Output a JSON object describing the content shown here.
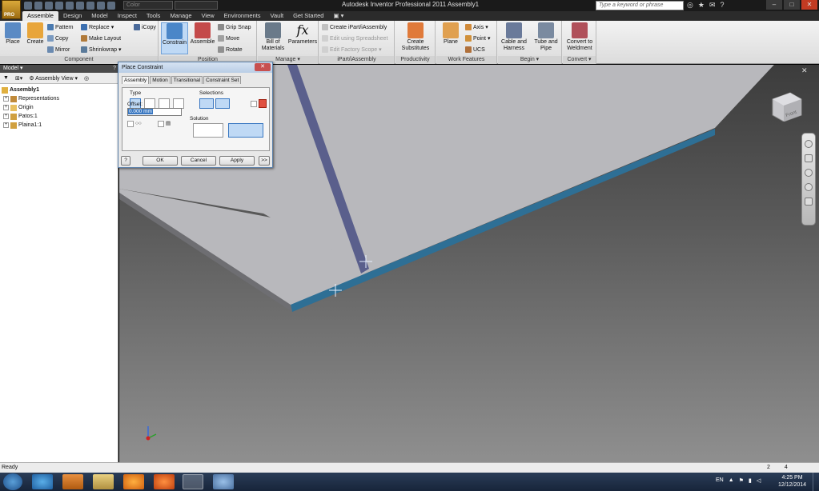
{
  "app": {
    "title": "Autodesk Inventor Professional 2011    Assembly1",
    "logo_text": "PRO",
    "color_combo": "Color",
    "search_placeholder": "Type a keyword or phrase",
    "window_buttons": [
      "–",
      "□",
      "✕"
    ]
  },
  "ribbon": {
    "tabs": [
      "Assemble",
      "Design",
      "Model",
      "Inspect",
      "Tools",
      "Manage",
      "View",
      "Environments",
      "Vault",
      "Get Started"
    ],
    "active_tab": "Assemble",
    "panels": {
      "component": {
        "label": "Component",
        "place": "Place",
        "create": "Create",
        "pattern": "Pattern",
        "copy": "Copy",
        "mirror": "Mirror",
        "replace": "Replace",
        "make_layout": "Make Layout",
        "shrinkwrap": "Shrinkwrap",
        "icopy": "iCopy"
      },
      "position": {
        "label": "Position",
        "constrain": "Constrain",
        "assemble": "Assemble",
        "grip_snap": "Grip Snap",
        "move": "Move",
        "rotate": "Rotate"
      },
      "manage": {
        "label": "Manage",
        "bom_line1": "Bill of",
        "bom_line2": "Materials",
        "parameters": "Parameters"
      },
      "ipart": {
        "label": "iPart/iAssembly",
        "create": "Create iPart/iAssembly",
        "edit_spreadsheet": "Edit using Spreadsheet",
        "edit_scope": "Edit Factory Scope"
      },
      "productivity": {
        "label": "Productivity",
        "create_line1": "Create",
        "create_line2": "Substitutes"
      },
      "work_features": {
        "label": "Work Features",
        "plane": "Plane",
        "axis": "Axis",
        "point": "Point",
        "ucs": "UCS"
      },
      "begin": {
        "label": "Begin",
        "cable_line1": "Cable and",
        "cable_line2": "Harness",
        "tube_line1": "Tube and",
        "tube_line2": "Pipe"
      },
      "convert": {
        "label": "Convert",
        "line1": "Convert to",
        "line2": "Weldment"
      }
    }
  },
  "browser": {
    "title": "Model",
    "view_label": "Assembly View",
    "tree": [
      {
        "label": "Assembly1",
        "bold": true,
        "level": 0
      },
      {
        "label": "Representations",
        "level": 1
      },
      {
        "label": "Origin",
        "level": 1
      },
      {
        "label": "Patos:1",
        "level": 1
      },
      {
        "label": "Plaina1:1",
        "level": 1
      }
    ]
  },
  "dialog": {
    "title": "Place Constraint",
    "tabs": [
      "Assembly",
      "Motion",
      "Transitional",
      "Constraint Set"
    ],
    "active_tab": "Assembly",
    "type_label": "Type",
    "selections_label": "Selections",
    "offset_label": "Offset:",
    "offset_value": "0.000 mm",
    "solution_label": "Solution",
    "ok": "OK",
    "cancel": "Cancel",
    "apply": "Apply",
    "more": ">>",
    "help": "?"
  },
  "viewcube_label": "Front",
  "status": {
    "text": "Ready",
    "count_a": "2",
    "count_b": "4"
  },
  "taskbar": {
    "language": "EN",
    "time": "4:25 PM",
    "date": "12/12/2014"
  },
  "colors": {
    "plate_top": "#b8b8bc",
    "plate_edge": "#2e6f95",
    "plate_vertical": "#5a5f8c",
    "viewport_top": "#3c3c3c",
    "viewport_bottom": "#8f8f8f"
  }
}
